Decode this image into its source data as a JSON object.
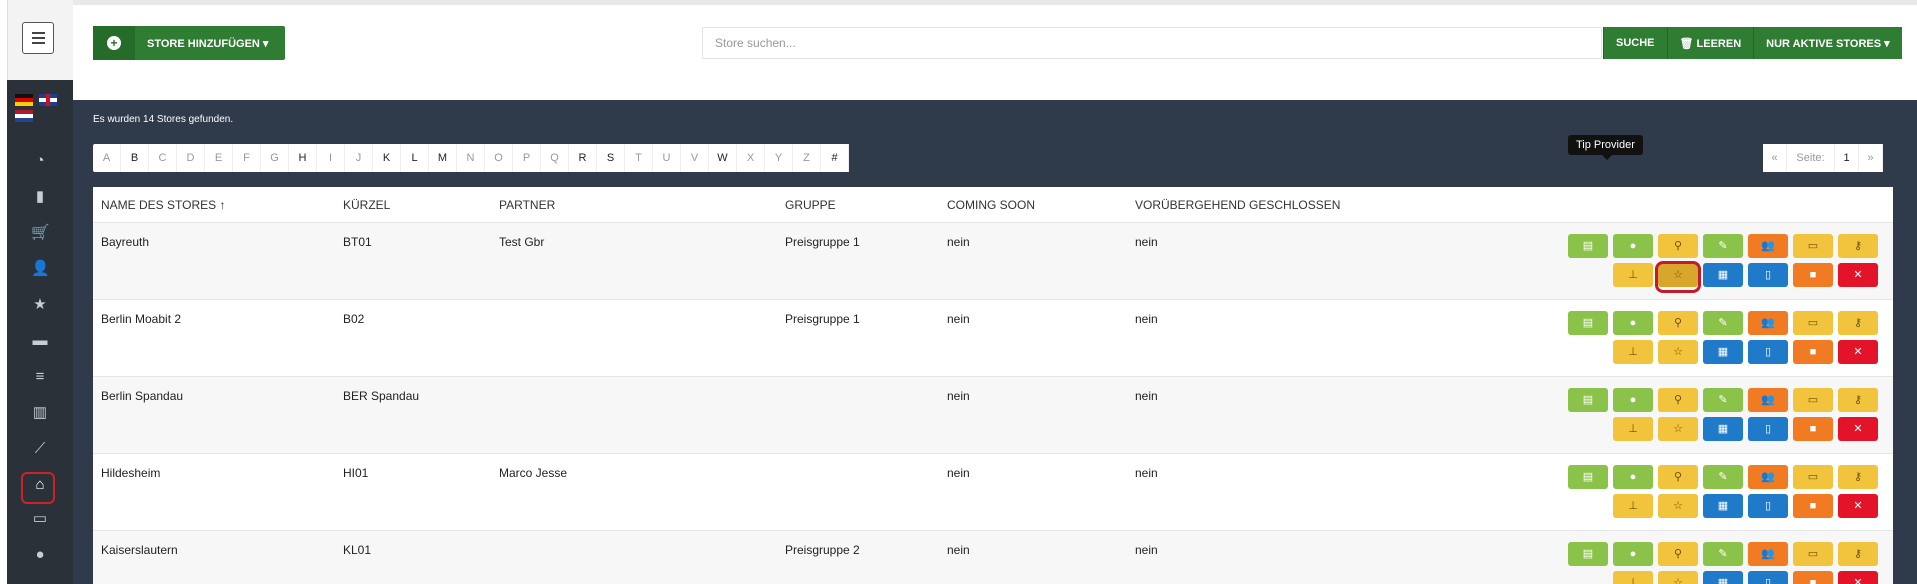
{
  "sidebar": {
    "menu_icon": "hamburger-icon",
    "items": [
      {
        "icon": "dashboard-icon",
        "glyph": "◔"
      },
      {
        "icon": "bar-chart-icon",
        "glyph": "▮"
      },
      {
        "icon": "cart-icon",
        "glyph": "🛒"
      },
      {
        "icon": "add-user-icon",
        "glyph": "👤"
      },
      {
        "icon": "star-icon",
        "glyph": "★"
      },
      {
        "icon": "archive-icon",
        "glyph": "▬"
      },
      {
        "icon": "list-icon",
        "glyph": "≡"
      },
      {
        "icon": "book-icon",
        "glyph": "▥"
      },
      {
        "icon": "trend-icon",
        "glyph": "⟋"
      },
      {
        "icon": "home-icon",
        "glyph": "⌂"
      },
      {
        "icon": "monitor-icon",
        "glyph": "▭"
      },
      {
        "icon": "user-icon",
        "glyph": "●"
      }
    ]
  },
  "toolbar": {
    "add_store_label": "STORE HINZUFÜGEN ▾",
    "search_placeholder": "Store suchen...",
    "search_label": "SUCHE",
    "clear_label": "🗑 LEEREN",
    "active_only_label": "NUR AKTIVE STORES ▾"
  },
  "content": {
    "found_text": "Es wurden 14 Stores gefunden.",
    "alphabet": [
      "A",
      "B",
      "C",
      "D",
      "E",
      "F",
      "G",
      "H",
      "I",
      "J",
      "K",
      "L",
      "M",
      "N",
      "O",
      "P",
      "Q",
      "R",
      "S",
      "T",
      "U",
      "V",
      "W",
      "X",
      "Y",
      "Z",
      "#"
    ],
    "active_letters": [
      "B",
      "H",
      "K",
      "L",
      "M",
      "R",
      "S",
      "W",
      "#"
    ],
    "pager": {
      "prev": "«",
      "page_label": "Seite:",
      "page": "1",
      "next": "»"
    }
  },
  "table": {
    "headers": [
      "NAME DES STORES ↑",
      "KÜRZEL",
      "PARTNER",
      "GRUPPE",
      "COMING SOON",
      "VORÜBERGEHEND GESCHLOSSEN"
    ],
    "rows": [
      [
        "Bayreuth",
        "BT01",
        "Test Gbr",
        "Preisgruppe 1",
        "nein",
        "nein"
      ],
      [
        "Berlin Moabit 2",
        "B02",
        "",
        "Preisgruppe 1",
        "nein",
        "nein"
      ],
      [
        "Berlin Spandau",
        "BER Spandau",
        "",
        "",
        "nein",
        "nein"
      ],
      [
        "Hildesheim",
        "HI01",
        "Marco Jesse",
        "",
        "nein",
        "nein"
      ],
      [
        "Kaiserslautern",
        "KL01",
        "",
        "Preisgruppe 2",
        "nein",
        "nein"
      ]
    ],
    "action_row1": [
      {
        "name": "details-icon",
        "glyph": "▤",
        "color": "g"
      },
      {
        "name": "location-icon",
        "glyph": "●",
        "color": "g"
      },
      {
        "name": "search-icon",
        "glyph": "⚲",
        "color": "y"
      },
      {
        "name": "edit-icon",
        "glyph": "✎",
        "color": "g"
      },
      {
        "name": "users-icon",
        "glyph": "👥",
        "color": "o"
      },
      {
        "name": "card-icon",
        "glyph": "▭",
        "color": "y"
      },
      {
        "name": "key-icon",
        "glyph": "⚷",
        "color": "y"
      }
    ],
    "action_row2": [
      {
        "name": "sitemap-icon",
        "glyph": "⊥",
        "color": "y"
      },
      {
        "name": "star-icon",
        "glyph": "☆",
        "color": "y"
      },
      {
        "name": "grid-icon",
        "glyph": "▦",
        "color": "b"
      },
      {
        "name": "mobile-icon",
        "glyph": "▯",
        "color": "b"
      },
      {
        "name": "lock-icon",
        "glyph": "■",
        "color": "o"
      },
      {
        "name": "delete-icon",
        "glyph": "✕",
        "color": "r"
      }
    ],
    "tooltip": "Tip Provider"
  },
  "colors": {
    "sidebar": "#2a3139",
    "content": "#2f3b4b",
    "primary_green": "#2e7d32",
    "highlight": "#c21c2a"
  }
}
